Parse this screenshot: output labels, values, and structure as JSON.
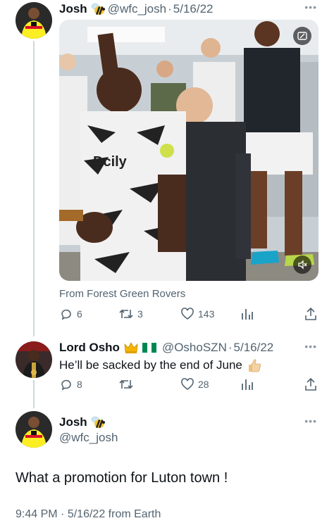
{
  "tweet1": {
    "name": "Josh",
    "handle": "@wfc_josh",
    "date": "5/16/22",
    "separator": "·",
    "media_source": "From Forest Green Rovers",
    "stats": {
      "replies": "6",
      "retweets": "3",
      "likes": "143"
    },
    "media_icons": [
      "gif-icon",
      "mute-icon"
    ],
    "jersey_text": "Dcily"
  },
  "reply": {
    "name": "Lord Osho",
    "handle": "@OshoSZN",
    "date": "5/16/22",
    "separator": "·",
    "text": "He’ll be sacked by the end of June",
    "emojis": [
      "crown",
      "nigeria-flag",
      "thumbs-up"
    ],
    "stats": {
      "replies": "8",
      "retweets": "",
      "likes": "28"
    }
  },
  "main_tweet": {
    "name": "Josh",
    "handle": "@wfc_josh",
    "text": "What a promotion for Luton town !",
    "time": "9:44 PM",
    "date": "5/16/22",
    "client": "from Earth",
    "separator": "·"
  },
  "colors": {
    "text": "#0f1419",
    "secondary": "#536471",
    "thread_line": "#cfd9de",
    "watford_yellow": "#fbee23",
    "watford_red": "#d8102c"
  }
}
